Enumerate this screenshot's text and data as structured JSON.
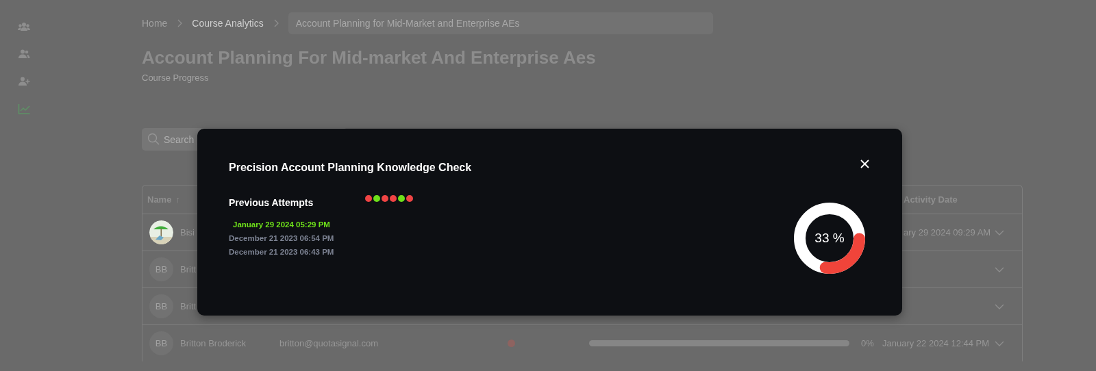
{
  "sidebar": {
    "items": [
      {
        "kind": "group",
        "selected": false
      },
      {
        "kind": "users",
        "selected": false
      },
      {
        "kind": "add-user",
        "selected": false
      },
      {
        "kind": "chart",
        "selected": true
      }
    ]
  },
  "breadcrumbs": {
    "items": [
      "Home",
      "Course Analytics"
    ],
    "current": "Account Planning for Mid-Market and Enterprise AEs"
  },
  "page": {
    "title": "Account Planning For Mid-market And Enterprise Aes",
    "subtitle": "Course Progress"
  },
  "search": {
    "placeholder": "Search"
  },
  "table": {
    "columns": [
      {
        "label": "Name",
        "sort_icon": "↑"
      },
      {
        "label": "Activity Date"
      }
    ],
    "rows": [
      {
        "name": "Bisi",
        "date": "ary 29 2024 09:29 AM"
      },
      {
        "avatar": {
          "kind": "initials",
          "text": "BB"
        },
        "name": "Britt"
      },
      {
        "avatar": {
          "kind": "initials",
          "text": "BB"
        },
        "name": "Britt"
      },
      {
        "avatar": {
          "kind": "initials",
          "text": "BB"
        },
        "name": "Britton Broderick",
        "email": "britton@quotasignal.com",
        "status_dot": {
          "color": "#8e6360"
        },
        "level": 0,
        "percent": "0%",
        "date": "January 22 2024 12:44 PM"
      }
    ]
  },
  "modal": {
    "title": "Precision Account Planning Knowledge Check",
    "section_title": "Previous Attempts",
    "attempts": [
      {
        "date": "January 29 2024 05:29 PM",
        "selected": true
      },
      {
        "date": "December 21 2023 06:54 PM",
        "selected": false
      },
      {
        "date": "December 21 2023 06:43 PM",
        "selected": false
      }
    ],
    "results": [
      {
        "color": "#ef4444"
      },
      {
        "color": "#6ee01a"
      },
      {
        "color": "#ef4444"
      },
      {
        "color": "#ef4444"
      },
      {
        "color": "#6ee01a"
      },
      {
        "color": "#ef4444"
      }
    ],
    "score": {
      "level": 0.33,
      "reading": "33 %"
    }
  }
}
